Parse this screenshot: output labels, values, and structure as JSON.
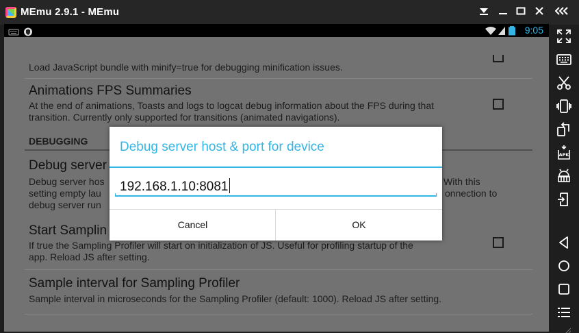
{
  "window": {
    "title": "MEmu 2.9.1 - MEmu",
    "buttons": {
      "dropdown": "▼",
      "minimize": "—",
      "maximize": "□",
      "close": "✕",
      "collapse": "«"
    }
  },
  "status_bar": {
    "time": "9:05",
    "battery_color": "#33b5e5"
  },
  "settings": {
    "minify_summary": "Load JavaScript bundle with minify=true for debugging minification issues.",
    "animations": {
      "title": "Animations FPS Summaries",
      "summary_line1": "At the end of animations, Toasts and logs to logcat debug information about the FPS during that",
      "summary_line2": "transition. Currently only supported for transitions (animated navigations)."
    },
    "debugging_header": "DEBUGGING",
    "debug_server": {
      "title": "Debug server",
      "summary_left1": "Debug server hos",
      "summary_right1": "With this",
      "summary_left2": "setting empty lau",
      "summary_right2": "onnection to",
      "summary_left3": "debug server run"
    },
    "sampling": {
      "title": "Start Samplin",
      "summary_line1": "If true the Sampling Profiler will start on initialization of JS. Useful for profiling startup of the",
      "summary_line2": "app. Reload JS after setting."
    },
    "sample_interval": {
      "title": "Sample interval for Sampling Profiler",
      "summary": "Sample interval in microseconds for the Sampling Profiler (default: 1000). Reload JS after setting."
    }
  },
  "dialog": {
    "title": "Debug server host & port for device",
    "input_value": "192.168.1.10:8081",
    "cancel_label": "Cancel",
    "ok_label": "OK",
    "accent": "#33b5e5"
  },
  "sidebar": {
    "icons": [
      "fullscreen-icon",
      "keyboard-icon",
      "scissors-icon",
      "shake-icon",
      "rotate-icon",
      "apk-install-icon",
      "android-robot-icon",
      "transfer-icon",
      "back-icon",
      "home-icon",
      "recents-icon",
      "menu-icon"
    ]
  }
}
